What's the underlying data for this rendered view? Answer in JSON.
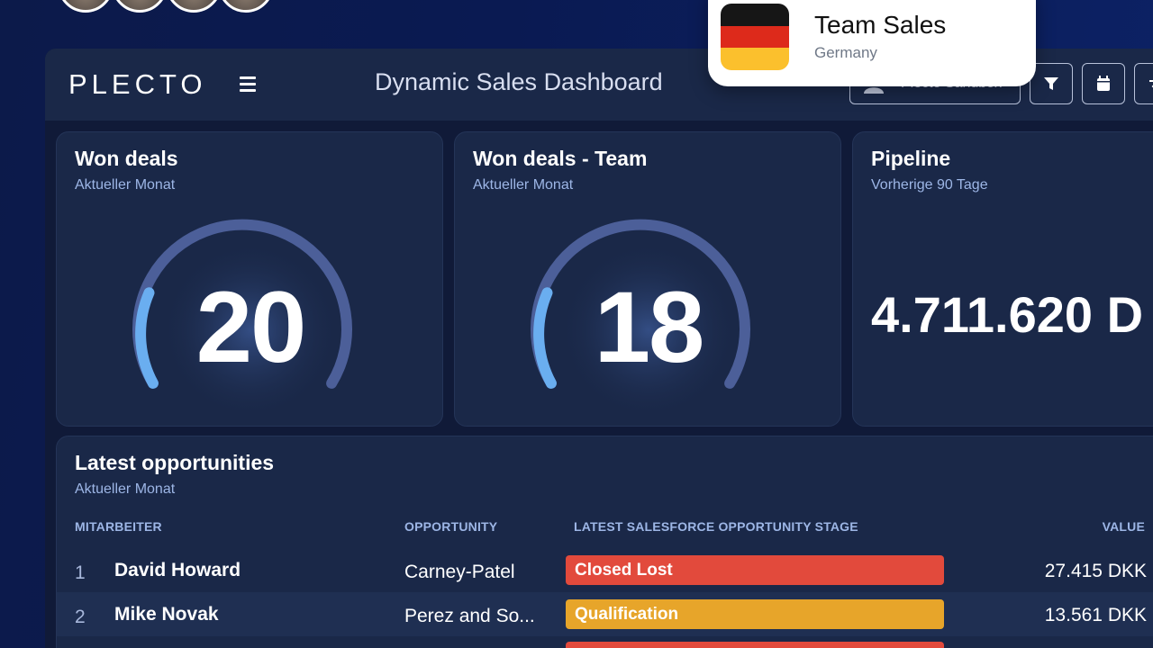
{
  "header": {
    "logo": "PLECTO",
    "title": "Dynamic Sales Dashboard",
    "account_label": "Plecto Sandbox"
  },
  "cards": [
    {
      "title": "Won deals",
      "subtitle": "Aktueller Monat",
      "value": "20",
      "gauge_fraction": 0.15
    },
    {
      "title": "Won deals - Team",
      "subtitle": "Aktueller Monat",
      "value": "18",
      "gauge_fraction": 0.15
    },
    {
      "title": "Pipeline",
      "subtitle": "Vorherige 90 Tage",
      "value": "4.711.620 D"
    }
  ],
  "table": {
    "title": "Latest opportunities",
    "subtitle": "Aktueller Monat",
    "columns": [
      "MITARBEITER",
      "OPPORTUNITY",
      "LATEST SALESFORCE OPPORTUNITY STAGE",
      "VALUE"
    ],
    "rows": [
      {
        "rank": "1",
        "name": "David Howard",
        "opportunity": "Carney-Patel",
        "stage": "Closed Lost",
        "value": "27.415 DKK"
      },
      {
        "rank": "2",
        "name": "Mike Novak",
        "opportunity": "Perez and So...",
        "stage": "Qualification",
        "value": "13.561 DKK"
      }
    ]
  },
  "toast": {
    "title": "Team Sales",
    "subtitle": "Germany"
  },
  "colors": {
    "closed_lost": "#e24a3c",
    "qualification": "#e7a52a",
    "gauge_track": "#4c5f99",
    "gauge_fill": "#6aaef0",
    "flag_black": "#161616",
    "flag_red": "#dd2a1b",
    "flag_gold": "#fbc02d"
  }
}
